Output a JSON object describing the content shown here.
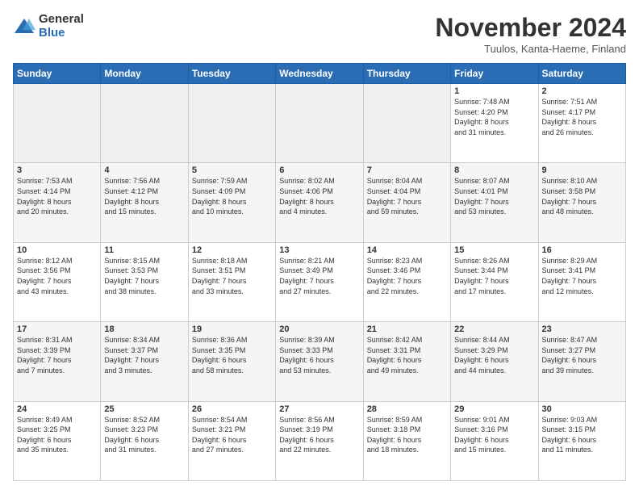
{
  "logo": {
    "general": "General",
    "blue": "Blue"
  },
  "header": {
    "month": "November 2024",
    "location": "Tuulos, Kanta-Haeme, Finland"
  },
  "days_of_week": [
    "Sunday",
    "Monday",
    "Tuesday",
    "Wednesday",
    "Thursday",
    "Friday",
    "Saturday"
  ],
  "weeks": [
    [
      {
        "day": "",
        "info": ""
      },
      {
        "day": "",
        "info": ""
      },
      {
        "day": "",
        "info": ""
      },
      {
        "day": "",
        "info": ""
      },
      {
        "day": "",
        "info": ""
      },
      {
        "day": "1",
        "info": "Sunrise: 7:48 AM\nSunset: 4:20 PM\nDaylight: 8 hours\nand 31 minutes."
      },
      {
        "day": "2",
        "info": "Sunrise: 7:51 AM\nSunset: 4:17 PM\nDaylight: 8 hours\nand 26 minutes."
      }
    ],
    [
      {
        "day": "3",
        "info": "Sunrise: 7:53 AM\nSunset: 4:14 PM\nDaylight: 8 hours\nand 20 minutes."
      },
      {
        "day": "4",
        "info": "Sunrise: 7:56 AM\nSunset: 4:12 PM\nDaylight: 8 hours\nand 15 minutes."
      },
      {
        "day": "5",
        "info": "Sunrise: 7:59 AM\nSunset: 4:09 PM\nDaylight: 8 hours\nand 10 minutes."
      },
      {
        "day": "6",
        "info": "Sunrise: 8:02 AM\nSunset: 4:06 PM\nDaylight: 8 hours\nand 4 minutes."
      },
      {
        "day": "7",
        "info": "Sunrise: 8:04 AM\nSunset: 4:04 PM\nDaylight: 7 hours\nand 59 minutes."
      },
      {
        "day": "8",
        "info": "Sunrise: 8:07 AM\nSunset: 4:01 PM\nDaylight: 7 hours\nand 53 minutes."
      },
      {
        "day": "9",
        "info": "Sunrise: 8:10 AM\nSunset: 3:58 PM\nDaylight: 7 hours\nand 48 minutes."
      }
    ],
    [
      {
        "day": "10",
        "info": "Sunrise: 8:12 AM\nSunset: 3:56 PM\nDaylight: 7 hours\nand 43 minutes."
      },
      {
        "day": "11",
        "info": "Sunrise: 8:15 AM\nSunset: 3:53 PM\nDaylight: 7 hours\nand 38 minutes."
      },
      {
        "day": "12",
        "info": "Sunrise: 8:18 AM\nSunset: 3:51 PM\nDaylight: 7 hours\nand 33 minutes."
      },
      {
        "day": "13",
        "info": "Sunrise: 8:21 AM\nSunset: 3:49 PM\nDaylight: 7 hours\nand 27 minutes."
      },
      {
        "day": "14",
        "info": "Sunrise: 8:23 AM\nSunset: 3:46 PM\nDaylight: 7 hours\nand 22 minutes."
      },
      {
        "day": "15",
        "info": "Sunrise: 8:26 AM\nSunset: 3:44 PM\nDaylight: 7 hours\nand 17 minutes."
      },
      {
        "day": "16",
        "info": "Sunrise: 8:29 AM\nSunset: 3:41 PM\nDaylight: 7 hours\nand 12 minutes."
      }
    ],
    [
      {
        "day": "17",
        "info": "Sunrise: 8:31 AM\nSunset: 3:39 PM\nDaylight: 7 hours\nand 7 minutes."
      },
      {
        "day": "18",
        "info": "Sunrise: 8:34 AM\nSunset: 3:37 PM\nDaylight: 7 hours\nand 3 minutes."
      },
      {
        "day": "19",
        "info": "Sunrise: 8:36 AM\nSunset: 3:35 PM\nDaylight: 6 hours\nand 58 minutes."
      },
      {
        "day": "20",
        "info": "Sunrise: 8:39 AM\nSunset: 3:33 PM\nDaylight: 6 hours\nand 53 minutes."
      },
      {
        "day": "21",
        "info": "Sunrise: 8:42 AM\nSunset: 3:31 PM\nDaylight: 6 hours\nand 49 minutes."
      },
      {
        "day": "22",
        "info": "Sunrise: 8:44 AM\nSunset: 3:29 PM\nDaylight: 6 hours\nand 44 minutes."
      },
      {
        "day": "23",
        "info": "Sunrise: 8:47 AM\nSunset: 3:27 PM\nDaylight: 6 hours\nand 39 minutes."
      }
    ],
    [
      {
        "day": "24",
        "info": "Sunrise: 8:49 AM\nSunset: 3:25 PM\nDaylight: 6 hours\nand 35 minutes."
      },
      {
        "day": "25",
        "info": "Sunrise: 8:52 AM\nSunset: 3:23 PM\nDaylight: 6 hours\nand 31 minutes."
      },
      {
        "day": "26",
        "info": "Sunrise: 8:54 AM\nSunset: 3:21 PM\nDaylight: 6 hours\nand 27 minutes."
      },
      {
        "day": "27",
        "info": "Sunrise: 8:56 AM\nSunset: 3:19 PM\nDaylight: 6 hours\nand 22 minutes."
      },
      {
        "day": "28",
        "info": "Sunrise: 8:59 AM\nSunset: 3:18 PM\nDaylight: 6 hours\nand 18 minutes."
      },
      {
        "day": "29",
        "info": "Sunrise: 9:01 AM\nSunset: 3:16 PM\nDaylight: 6 hours\nand 15 minutes."
      },
      {
        "day": "30",
        "info": "Sunrise: 9:03 AM\nSunset: 3:15 PM\nDaylight: 6 hours\nand 11 minutes."
      }
    ]
  ]
}
